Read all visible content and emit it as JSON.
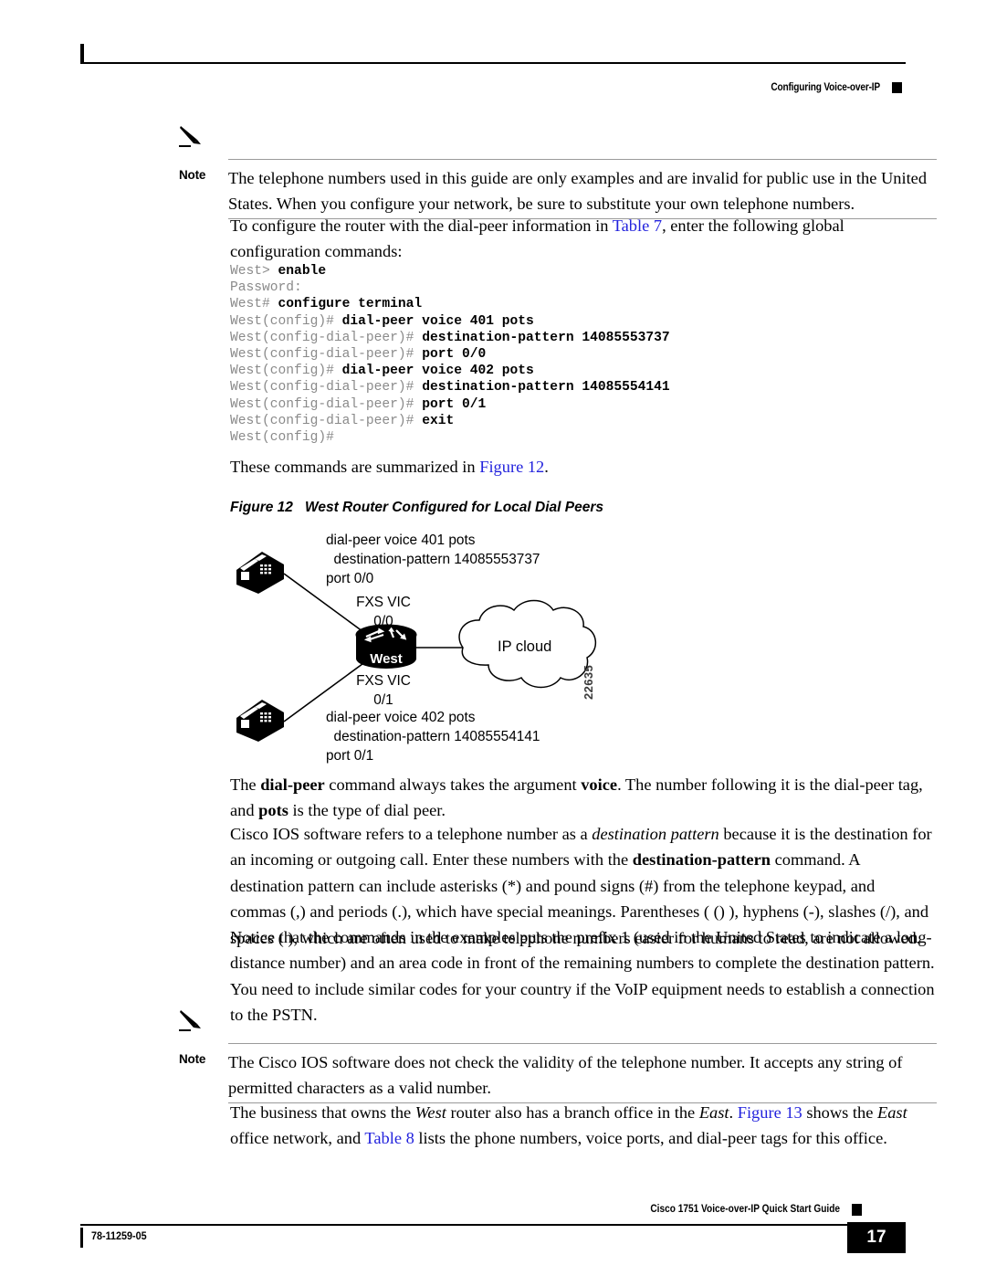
{
  "header": {
    "title": "Configuring Voice-over-IP"
  },
  "notes": [
    {
      "label": "Note",
      "icon": "pencil-icon",
      "text": "The telephone numbers used in this guide are only examples and are invalid for public use in the United States. When you configure your network, be sure to substitute your own telephone numbers."
    },
    {
      "label": "Note",
      "icon": "pencil-icon",
      "text": "The Cisco IOS software does not check the validity of the telephone number. It accepts any string of permitted characters as a valid number."
    }
  ],
  "paragraphs": {
    "intro_1": "To configure the router with the dial-peer information in ",
    "intro_link": "Table 7",
    "intro_2": ", enter the following global configuration commands:",
    "summary_1": "These commands are summarized in ",
    "summary_link": "Figure 12",
    "summary_2": ".",
    "dialpeer_1": "The ",
    "dialpeer_b1": "dial-peer",
    "dialpeer_2": " command always takes the argument ",
    "dialpeer_b2": "voice",
    "dialpeer_3": ". The number following it is the dial-peer tag, and ",
    "dialpeer_b3": "pots",
    "dialpeer_4": " is the type of dial peer.",
    "destpat_1": "Cisco IOS software refers to a telephone number as a ",
    "destpat_i1": "destination pattern",
    "destpat_2": " because it is the destination for an incoming or outgoing call. Enter these numbers with the ",
    "destpat_b1": "destination-pattern",
    "destpat_3": " command. A destination pattern can include asterisks (*) and pound signs (#) from the telephone keypad, and commas (,) and periods (.), which have special meanings. Parentheses ( () ), hyphens (-), slashes (/), and spaces ( ), which are often used to make telephone numbers easier for humans to read, are not allowed.",
    "prefix": "Notice that the commands in the examples puts the prefix 1 (used in the United States to indicate a long-distance number) and an area code in front of the remaining numbers to complete the destination pattern. You need to include similar codes for your country if the VoIP equipment needs to establish a connection to the PSTN.",
    "branch_1": "The business that owns the ",
    "branch_i1": "West",
    "branch_2": " router also has a branch office in the ",
    "branch_i2": "East",
    "branch_3": ". ",
    "branch_link1": "Figure 13",
    "branch_4": " shows the ",
    "branch_i3": "East",
    "branch_5": " office network, and ",
    "branch_link2": "Table 8",
    "branch_6": " lists the phone numbers, voice ports, and dial-peer tags for this office."
  },
  "code_block": {
    "lines": [
      {
        "prompt": "West> ",
        "cmd": "enable"
      },
      {
        "prompt": "Password:",
        "cmd": ""
      },
      {
        "prompt": "West# ",
        "cmd": "configure terminal"
      },
      {
        "prompt": "West(config)# ",
        "cmd": "dial-peer voice 401 pots"
      },
      {
        "prompt": "West(config-dial-peer)# ",
        "cmd": "destination-pattern 14085553737"
      },
      {
        "prompt": "West(config-dial-peer)# ",
        "cmd": "port 0/0"
      },
      {
        "prompt": "West(config)# ",
        "cmd": "dial-peer voice 402 pots"
      },
      {
        "prompt": "West(config-dial-peer)# ",
        "cmd": "destination-pattern 14085554141"
      },
      {
        "prompt": "West(config-dial-peer)# ",
        "cmd": "port 0/1"
      },
      {
        "prompt": "West(config-dial-peer)# ",
        "cmd": "exit"
      },
      {
        "prompt": "West(config)#",
        "cmd": ""
      }
    ]
  },
  "figure": {
    "number_label": "Figure 12",
    "title": "West Router Configured for Local Dial Peers",
    "graphic_id": "22635",
    "labels": {
      "top_line1": "dial-peer voice 401 pots",
      "top_line2": "  destination-pattern 14085553737",
      "top_line3": "port 0/0",
      "fxs_top_line1": "FXS VIC",
      "fxs_top_line2": "0/0",
      "router_name": "West",
      "cloud_name": "IP cloud",
      "fxs_bottom_line1": "FXS VIC",
      "fxs_bottom_line2": "0/1",
      "bottom_line1": "dial-peer voice 402 pots",
      "bottom_line2": "  destination-pattern 14085554141",
      "bottom_line3": "port 0/1"
    }
  },
  "footer": {
    "doc_id": "78-11259-05",
    "guide_title": "Cisco 1751 Voice-over-IP Quick Start Guide",
    "page_number": "17"
  }
}
